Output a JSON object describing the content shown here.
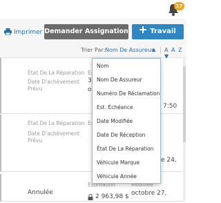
{
  "header": {
    "notification_count": "17"
  },
  "toolbar": {
    "print_label": "Imprimer",
    "assign_label": "Demander Assignation",
    "new_work_label": "Travail"
  },
  "sort": {
    "label": "Trier Par:",
    "value": "Nom De Assureur",
    "order_label": "A A Z"
  },
  "dropdown": {
    "options": [
      "Nom",
      "Nom De Assureur",
      "Numéro De Réclamation",
      "Est. Échéance",
      "Date Modifiée",
      "Date De Réception",
      "État De La Réparation",
      "Véhicule Marque",
      "Véhicule Année"
    ]
  },
  "cards": [
    {
      "status_label": "État De La Réparation",
      "due_label": "Date D'achèvement Prévu",
      "partial_top": "Es",
      "partial_amount": "36",
      "partial_date": "oc",
      "partial_time": "7:50"
    },
    {
      "status_label": "État De La Réparation",
      "due_label": "Date D'achèvement Prévu",
      "partial_top": "Es",
      "partial_date": "e 24,"
    },
    {
      "status_value": "Annulée",
      "estimate_label": "Estimation",
      "estimate_value": "2 963,98 $",
      "modified_label": "Modifiée",
      "modified_value": "octobre 27,"
    }
  ]
}
